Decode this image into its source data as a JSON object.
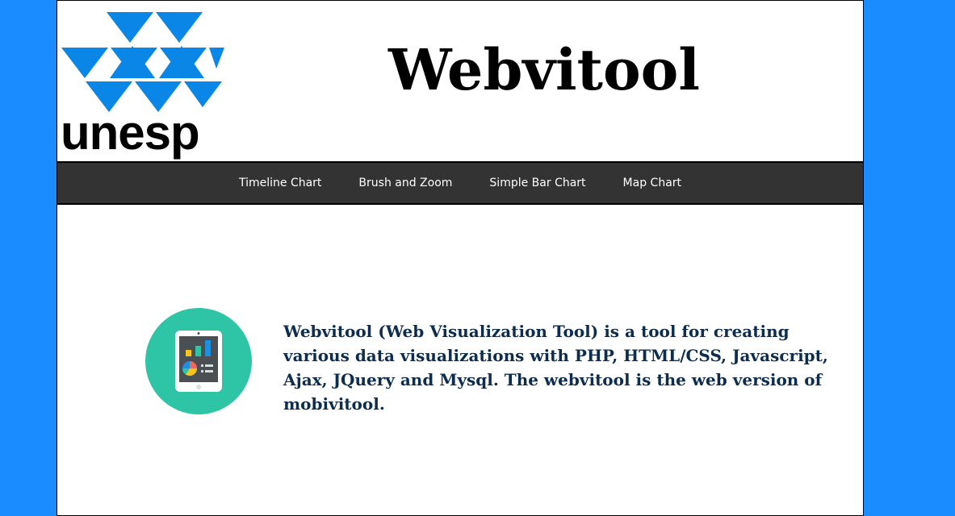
{
  "header": {
    "logo_text": "unesp",
    "title": "Webvitool"
  },
  "nav": {
    "items": [
      {
        "label": "Timeline Chart"
      },
      {
        "label": "Brush and Zoom"
      },
      {
        "label": "Simple Bar Chart"
      },
      {
        "label": "Map Chart"
      }
    ]
  },
  "main": {
    "icon": "tablet-chart-icon",
    "description": "Webvitool (Web Visualization Tool) is a tool for creating various data visualizations with PHP, HTML/CSS, Javascript, Ajax, JQuery and Mysql. The webvitool is the web version of mobivitool."
  },
  "colors": {
    "background": "#1a8cff",
    "logo_blue": "#0a86e6",
    "navbar": "#333333",
    "text_dark_blue": "#0d2c4e",
    "icon_teal": "#2ec4a6"
  }
}
